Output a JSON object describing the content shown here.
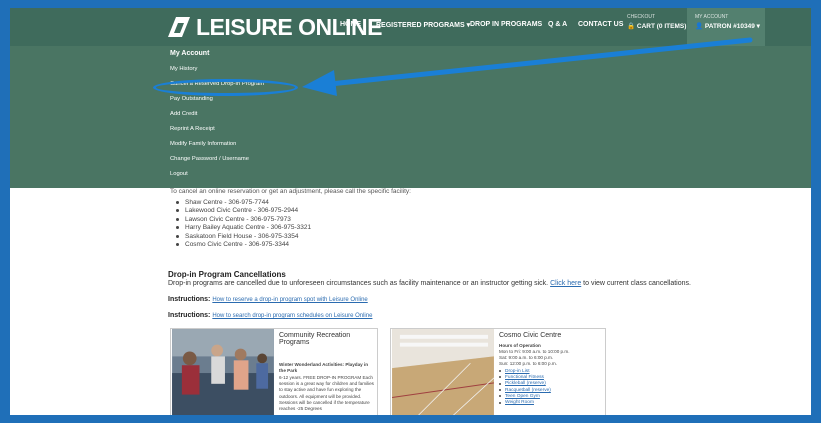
{
  "brand": {
    "name": "LEISURE ONLINE",
    "primary": "#3f6b5c",
    "dropdown_bg": "#4a7563",
    "annotation": "#1a7fd6",
    "link": "#2a6bb0"
  },
  "nav": {
    "home": "HOME",
    "registered": "REGISTERED PROGRAMS ▾",
    "dropin": "DROP IN PROGRAMS",
    "qa": "Q & A",
    "contact": "CONTACT US",
    "checkout_label": "CHECKOUT",
    "cart": "🔒 CART (0 ITEMS)",
    "myaccount_label": "MY ACCOUNT",
    "patron": "👤 PATRON #10349 ▾"
  },
  "dropdown": {
    "heading": "My Account",
    "items": [
      "My History",
      "Cancel a Reserved Drop-In Program",
      "Pay Outstanding",
      "Add Credit",
      "Reprint A Receipt",
      "Modify Family Information",
      "Change Password / Username",
      "Logout"
    ]
  },
  "content": {
    "intro": "To cancel an online reservation or get an adjustment, please call the specific facility:",
    "facilities": [
      "Shaw Centre - 306-975-7744",
      "Lakewood Civic Centre - 306-975-2944",
      "Lawson Civic Centre - 306-975-7973",
      "Harry Bailey Aquatic Centre - 306-975-3321",
      "Saskatoon Field House - 306-975-3354",
      "Cosmo Civic Centre - 306-975-3344"
    ],
    "cancel_heading": "Drop-in Program Cancellations",
    "cancel_text": "Drop-in programs are cancelled due to unforeseen circumstances such as facility maintenance or an instructor getting sick.",
    "click_here": "Click here",
    "cancel_text_end": "to view current class cancellations.",
    "instr1_label": "Instructions:",
    "instr1_link": "How to reserve a drop-in program spot with Leisure Online",
    "instr2_label": "Instructions:",
    "instr2_link": "How to search drop-in program schedules on Leisure Online"
  },
  "card1": {
    "title": "Community Recreation Programs",
    "subtitle": "Winter Wonderland Activities: Playday in the Park",
    "body": "6-12 years. FREE DROP-IN PROGRAM Each session is a great way for children and families to stay active and have fun exploring the outdoors. All equipment will be provided. Sessions will be cancelled if the temperature reaches -25 Degrees"
  },
  "card2": {
    "title": "Cosmo Civic Centre",
    "hours_heading": "Hours of Operation",
    "hours": [
      "Mon to Fri: 9:00 a.m. to 10:00 p.m.",
      "Sat: 9:00 a.m. to 6:00 p.m.",
      "Sun: 12:00 p.m. to 6:00 p.m."
    ],
    "links": [
      "Drop-in List",
      "Functional Fitness",
      "Pickleball (reserve)",
      "Racquetball (reserve)",
      "Teen Open Gym",
      "Weight Room"
    ]
  }
}
